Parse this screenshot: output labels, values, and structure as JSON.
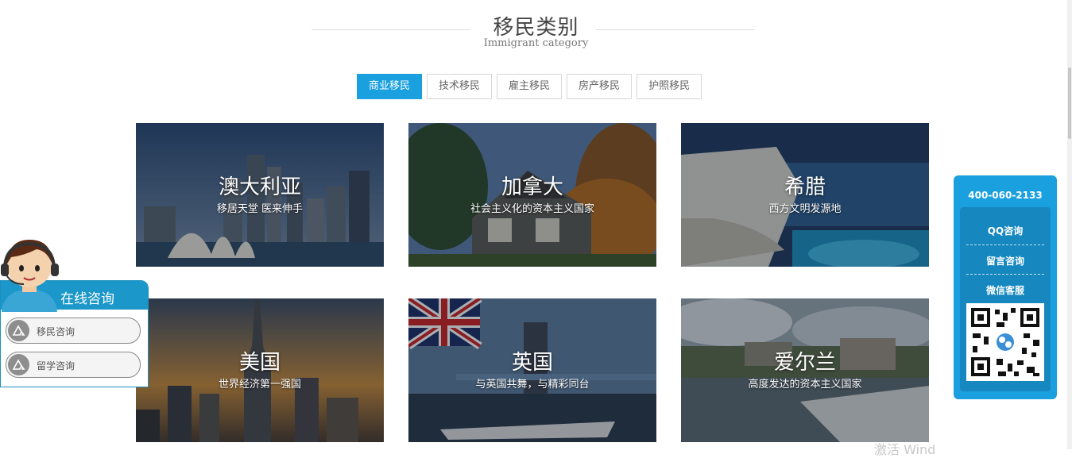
{
  "section": {
    "title": "移民类别",
    "subtitle": "Immigrant category"
  },
  "tabs": [
    {
      "label": "商业移民",
      "active": true
    },
    {
      "label": "技术移民",
      "active": false
    },
    {
      "label": "雇主移民",
      "active": false
    },
    {
      "label": "房产移民",
      "active": false
    },
    {
      "label": "护照移民",
      "active": false
    }
  ],
  "cards": [
    {
      "name": "澳大利亚",
      "desc": "移居天堂 医来伸手"
    },
    {
      "name": "加拿大",
      "desc": "社会主义化的资本主义国家"
    },
    {
      "name": "希腊",
      "desc": "西方文明发源地"
    },
    {
      "name": "美国",
      "desc": "世界经济第一强国"
    },
    {
      "name": "英国",
      "desc": "与英国共舞，与精彩同台"
    },
    {
      "name": "爱尔兰",
      "desc": "高度发达的资本主义国家"
    }
  ],
  "consult": {
    "title": "在线咨询",
    "items": [
      "移民咨询",
      "留学咨询"
    ]
  },
  "contact": {
    "phone": "400-060-2133",
    "items": [
      "QQ咨询",
      "留言咨询",
      "微信客服"
    ]
  },
  "watermark": "激活 Wind",
  "colors": {
    "accent": "#1ba0df",
    "accent_dark": "#1688bf",
    "consult_head": "#1c97c9"
  }
}
